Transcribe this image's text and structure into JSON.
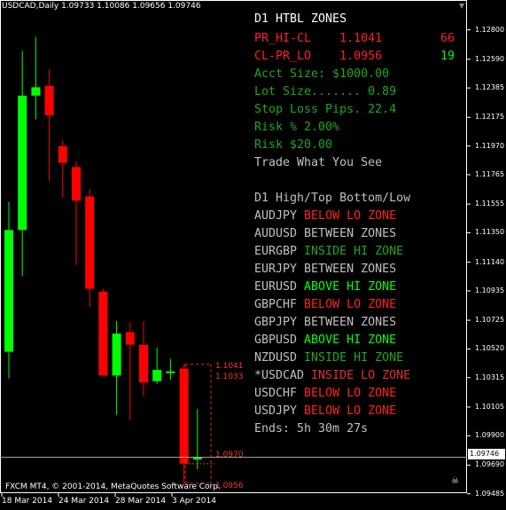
{
  "header": {
    "title": "USDCAD,Daily  1.09733 1.10086 1.09656 1.09746"
  },
  "footer": {
    "copyright": "FXCM MT4, © 2001-2014, MetaQuotes Software Corp."
  },
  "colors": {
    "bull": "#00ff00",
    "bear": "#ff0000",
    "grid": "#ffffff",
    "bg": "#000000",
    "text_gray": "#c0c0c0",
    "text_green": "#1fa61f",
    "text_red": "#ff2020",
    "text_lime": "#00ff00"
  },
  "panel": {
    "title": "D1 HTBL ZONES",
    "pr_hi_cl": {
      "label": "PR_HI-CL",
      "value": "1.1041",
      "count": "66"
    },
    "cl_pr_lo": {
      "label": "CL-PR_LO",
      "value": "1.0956",
      "count": "19"
    },
    "acct_size": "Acct Size: $1000.00",
    "lot_size": "Lot Size....... 0.89",
    "stop_loss": "Stop Loss Pips. 22.4",
    "risk_pct": "Risk % 2.00%",
    "risk_usd": "Risk $20.00",
    "motto": "Trade What You See",
    "subtitle": "D1 High/Top Bottom/Low",
    "pairs": [
      {
        "symbol": "AUDJPY",
        "status": "BELOW LO ZONE",
        "sym_color": "#c0c0c0",
        "st_color": "#ff2020"
      },
      {
        "symbol": "AUDUSD",
        "status": "BETWEEN ZONES",
        "sym_color": "#c0c0c0",
        "st_color": "#c0c0c0"
      },
      {
        "symbol": "EURGBP",
        "status": "INSIDE HI ZONE",
        "sym_color": "#c0c0c0",
        "st_color": "#1fa61f"
      },
      {
        "symbol": "EURJPY",
        "status": "BETWEEN ZONES",
        "sym_color": "#c0c0c0",
        "st_color": "#c0c0c0"
      },
      {
        "symbol": "EURUSD",
        "status": "ABOVE HI ZONE",
        "sym_color": "#c0c0c0",
        "st_color": "#00ff00"
      },
      {
        "symbol": "GBPCHF",
        "status": "BELOW LO ZONE",
        "sym_color": "#c0c0c0",
        "st_color": "#ff2020"
      },
      {
        "symbol": "GBPJPY",
        "status": "BETWEEN ZONES",
        "sym_color": "#c0c0c0",
        "st_color": "#c0c0c0"
      },
      {
        "symbol": "GBPUSD",
        "status": "ABOVE HI ZONE",
        "sym_color": "#c0c0c0",
        "st_color": "#00ff00"
      },
      {
        "symbol": "NZDUSD",
        "status": "INSIDE HI ZONE",
        "sym_color": "#c0c0c0",
        "st_color": "#1fa61f"
      },
      {
        "symbol": "*USDCAD",
        "status": "INSIDE LO ZONE",
        "sym_color": "#c0c0c0",
        "st_color": "#e03030"
      },
      {
        "symbol": "USDCHF",
        "status": "BELOW LO ZONE",
        "sym_color": "#c0c0c0",
        "st_color": "#ff2020"
      },
      {
        "symbol": "USDJPY",
        "status": "BELOW LO ZONE",
        "sym_color": "#c0c0c0",
        "st_color": "#ff2020"
      }
    ],
    "ends": "Ends: 5h 30m 27s"
  },
  "levels": {
    "hi1": "1.1041",
    "hi2": "1.1033",
    "close": "1.0970",
    "lo": "1.0956",
    "current": "1.09746"
  },
  "chart_data": {
    "type": "candlestick",
    "y_ticks": [
      "1.12800",
      "1.12590",
      "1.12385",
      "1.12175",
      "1.11970",
      "1.11765",
      "1.11555",
      "1.11350",
      "1.11140",
      "1.10935",
      "1.10725",
      "1.10520",
      "1.10315",
      "1.10105",
      "1.09900",
      "1.09690",
      "1.09485"
    ],
    "x_labels": [
      "18 Mar 2014",
      "24 Mar 2014",
      "28 Mar 2014",
      "3 Apr 2014"
    ],
    "ylim": [
      1.0942,
      1.1295
    ],
    "current_price": 1.09746,
    "candles": [
      {
        "o": 1.105,
        "h": 1.1157,
        "l": 1.1031,
        "c": 1.1137,
        "bull": true
      },
      {
        "o": 1.1137,
        "h": 1.1265,
        "l": 1.1104,
        "c": 1.1233,
        "bull": true
      },
      {
        "o": 1.1233,
        "h": 1.1275,
        "l": 1.1216,
        "c": 1.1239,
        "bull": true
      },
      {
        "o": 1.124,
        "h": 1.1252,
        "l": 1.1172,
        "c": 1.1219,
        "bull": false
      },
      {
        "o": 1.1197,
        "h": 1.1201,
        "l": 1.116,
        "c": 1.1185,
        "bull": false
      },
      {
        "o": 1.1182,
        "h": 1.1186,
        "l": 1.1112,
        "c": 1.1158,
        "bull": false
      },
      {
        "o": 1.1161,
        "h": 1.1166,
        "l": 1.1082,
        "c": 1.1095,
        "bull": false
      },
      {
        "o": 1.1093,
        "h": 1.1095,
        "l": 1.1033,
        "c": 1.1033,
        "bull": false
      },
      {
        "o": 1.1033,
        "h": 1.1072,
        "l": 1.1005,
        "c": 1.1063,
        "bull": true
      },
      {
        "o": 1.1064,
        "h": 1.1071,
        "l": 1.1001,
        "c": 1.1055,
        "bull": false
      },
      {
        "o": 1.1055,
        "h": 1.1072,
        "l": 1.1018,
        "c": 1.1028,
        "bull": false
      },
      {
        "o": 1.1037,
        "h": 1.1053,
        "l": 1.1027,
        "c": 1.1029,
        "bull": true
      },
      {
        "o": 1.1036,
        "h": 1.1045,
        "l": 1.103,
        "c": 1.1036,
        "bull": true
      },
      {
        "o": 1.1038,
        "h": 1.1041,
        "l": 1.0956,
        "c": 1.097,
        "bull": false
      },
      {
        "o": 1.0973,
        "h": 1.1009,
        "l": 1.0966,
        "c": 1.0975,
        "bull": true
      }
    ]
  }
}
